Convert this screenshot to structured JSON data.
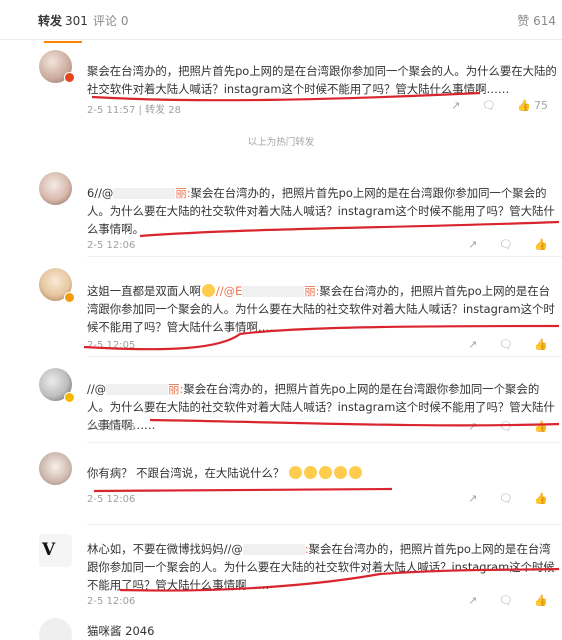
{
  "tabs": {
    "repost_label": "转发",
    "repost_count": "301",
    "comment_label": "评论",
    "comment_count": "0",
    "like_label": "赞",
    "like_count": "614"
  },
  "hot_divider": "以上为热门转发",
  "posts": [
    {
      "text": "聚会在台湾办的，把照片首先po上网的是在台湾跟你参加同一个聚会的人。为什么要在大陆的社交软件对着大陆人喊话？instagram这个时候不能用了吗？管大陆什么事情啊……",
      "meta": "2-5 11:57 | 转发 28",
      "like_count": "75"
    },
    {
      "prefix": "6//@",
      "mention_tail": "丽:",
      "text": "聚会在台湾办的，把照片首先po上网的是在台湾跟你参加同一个聚会的人。为什么要在大陆的社交软件对着大陆人喊话？instagram这个时候不能用了吗？管大陆什么事情啊。",
      "meta": "2-5 12:06"
    },
    {
      "prefix": "这姐一直都是双面人啊",
      "mention_head": "//@E",
      "mention_tail": "丽:",
      "text": "聚会在台湾办的，把照片首先po上网的是在台湾跟你参加同一个聚会的人。为什么要在大陆的社交软件对着大陆人喊话？instagram这个时候不能用了吗？管大陆什么事情啊……",
      "meta": "2-5 12:05"
    },
    {
      "prefix": "//@",
      "mention_tail": "丽:",
      "text": "聚会在台湾办的，把照片首先po上网的是在台湾跟你参加同一个聚会的人。为什么要在大陆的社交软件对着大陆人喊话？instagram这个时候不能用了吗？管大陆什么事情啊……",
      "meta": "2-5 12:06"
    },
    {
      "text": "你有病？ 不跟台湾说，在大陆说什么？",
      "meta": "2-5 12:06"
    },
    {
      "prefix": "林心如，不要在微博找妈妈//@",
      "mention_tail": ":",
      "text": "聚会在台湾办的，把照片首先po上网的是在台湾跟你参加同一个聚会的人。为什么要在大陆的社交软件对着大陆人喊话？instagram这个时候不能用了吗？管大陆什么事情啊……",
      "meta": "2-5 12:06"
    }
  ],
  "footer_name": "猫咪酱 2046",
  "icons": {
    "share": "share-icon",
    "comment": "comment-icon",
    "like": "thumbs-up-icon"
  },
  "colors": {
    "accent": "#ff8200",
    "mention": "#eb7350",
    "annotation": "#d9262e"
  }
}
